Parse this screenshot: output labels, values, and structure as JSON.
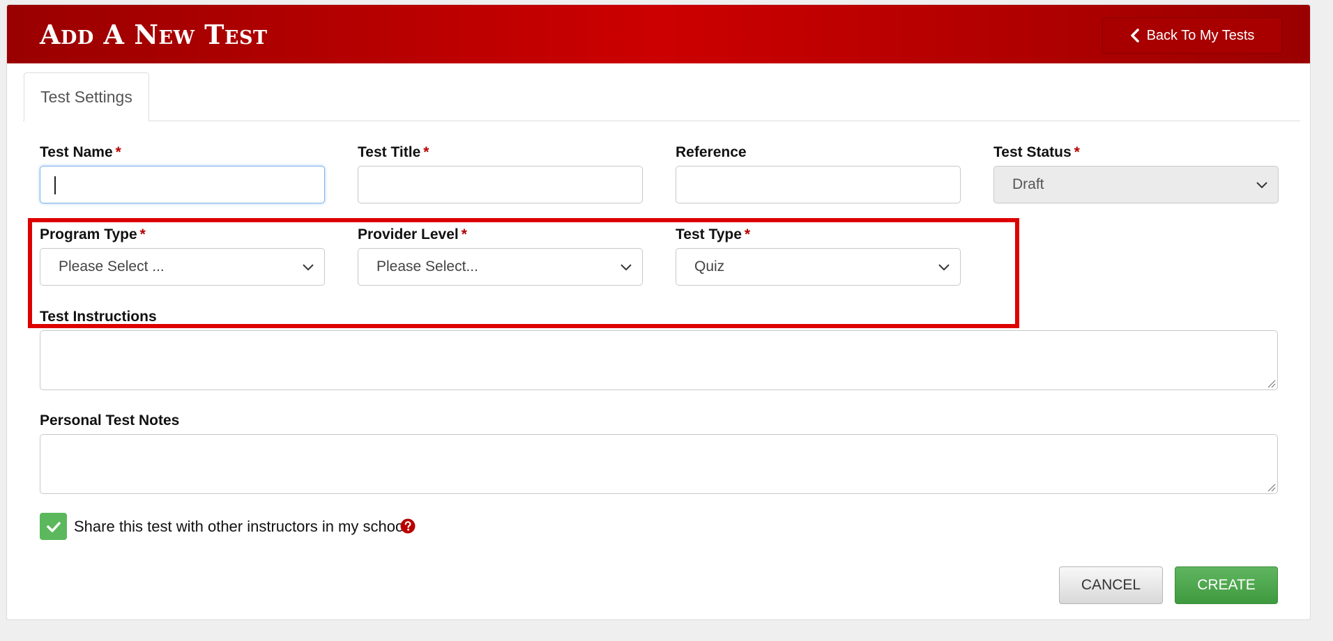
{
  "header": {
    "title": "Add A New Test",
    "back_label": "Back To My Tests",
    "back_icon": "chevron-left-icon"
  },
  "tabs": [
    {
      "label": "Test Settings",
      "active": true
    }
  ],
  "form": {
    "required_marker": "*",
    "test_name": {
      "label": "Test Name",
      "value": ""
    },
    "test_title": {
      "label": "Test Title",
      "value": ""
    },
    "reference": {
      "label": "Reference",
      "value": ""
    },
    "test_status": {
      "label": "Test Status",
      "selected": "Draft"
    },
    "program_type": {
      "label": "Program Type",
      "selected": "Please Select ..."
    },
    "provider_level": {
      "label": "Provider Level",
      "selected": "Please Select..."
    },
    "test_type": {
      "label": "Test Type",
      "selected": "Quiz"
    },
    "test_instructions": {
      "label": "Test Instructions",
      "value": ""
    },
    "personal_notes": {
      "label": "Personal Test Notes",
      "value": ""
    },
    "share": {
      "label": "Share this test with other instructors in my school",
      "checked": true
    }
  },
  "actions": {
    "cancel_label": "CANCEL",
    "create_label": "CREATE"
  },
  "colors": {
    "header_red": "#cc0000",
    "required_red": "#b80000",
    "highlight_red": "#dd0000",
    "success_green": "#5cb85c",
    "focus_blue": "#7fb4ea"
  }
}
